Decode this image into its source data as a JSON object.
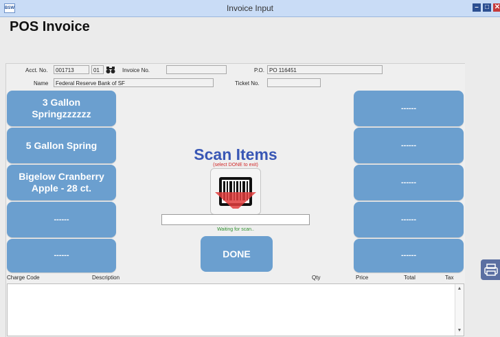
{
  "window": {
    "title": "Invoice Input",
    "app_icon_text": "BSW",
    "minimize_label": "–",
    "maximize_label": "□",
    "close_label": "✕"
  },
  "page": {
    "title": "POS Invoice"
  },
  "header": {
    "acct_no_label": "Acct. No.",
    "acct_no_value": "001713",
    "acct_suffix_value": "01",
    "invoice_no_label": "Invoice No.",
    "invoice_no_value": "",
    "po_label": "P.O.",
    "po_value": "PO 116451",
    "name_label": "Name",
    "name_value": "Federal Reserve Bank of SF",
    "ticket_no_label": "Ticket No.",
    "ticket_no_value": "",
    "lookup_icon": "binoculars-icon"
  },
  "left_tiles": [
    {
      "label": "3 Gallon Springzzzzzz"
    },
    {
      "label": "5 Gallon Spring"
    },
    {
      "label": "Bigelow Cranberry Apple - 28 ct."
    },
    {
      "label": "------"
    },
    {
      "label": "------"
    }
  ],
  "right_tiles": [
    {
      "label": "------"
    },
    {
      "label": "------"
    },
    {
      "label": "------"
    },
    {
      "label": "------"
    },
    {
      "label": "------"
    }
  ],
  "scan": {
    "title": "Scan Items",
    "subtitle": "(select DONE to exit)",
    "input_value": "",
    "status": "Waiting for scan..",
    "done_label": "DONE",
    "icon": "barcode-scanner-icon"
  },
  "grid": {
    "columns": [
      "Charge Code",
      "Description",
      "Qty",
      "Price",
      "Total",
      "Tax"
    ]
  },
  "side": {
    "print_icon": "printer-icon"
  },
  "colors": {
    "tile": "#6b9fcf",
    "scan_title": "#3957b5",
    "scan_subtitle": "#d02626",
    "status": "#2f8f2f",
    "titlebar": "#c9dcf6"
  }
}
